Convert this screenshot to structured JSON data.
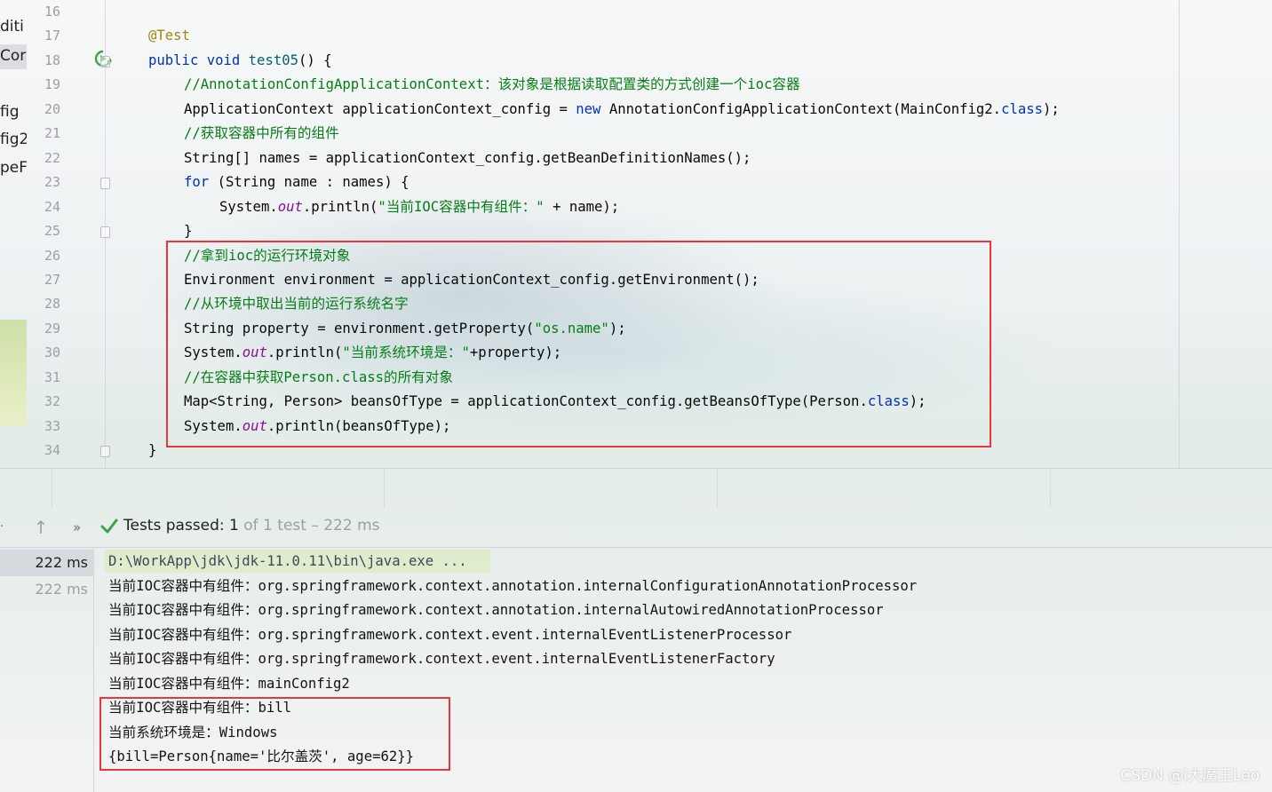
{
  "sidebar": {
    "fragments": [
      "diti",
      "Cor",
      "fig",
      "fig2",
      "peF"
    ]
  },
  "editor": {
    "line_numbers": [
      "16",
      "17",
      "18",
      "19",
      "20",
      "21",
      "22",
      "23",
      "24",
      "25",
      "26",
      "27",
      "28",
      "29",
      "30",
      "31",
      "32",
      "33",
      "34"
    ],
    "lines": [
      {
        "n": "16",
        "segments": []
      },
      {
        "n": "17",
        "segments": [
          {
            "t": "@Test",
            "c": "ann"
          }
        ],
        "indent": 1
      },
      {
        "n": "18",
        "segments": [
          {
            "t": "public ",
            "c": "kw"
          },
          {
            "t": "void ",
            "c": "kw"
          },
          {
            "t": "test05",
            "c": "fn"
          },
          {
            "t": "() {",
            "c": ""
          }
        ],
        "indent": 1
      },
      {
        "n": "19",
        "segments": [
          {
            "t": "//AnnotationConfigApplicationContext：该对象是根据读取配置类的方式创建一个ioc容器",
            "c": "cmt"
          }
        ],
        "indent": 2
      },
      {
        "n": "20",
        "segments": [
          {
            "t": "ApplicationContext applicationContext_config = ",
            "c": ""
          },
          {
            "t": "new ",
            "c": "kw"
          },
          {
            "t": "AnnotationConfigApplicationContext(MainConfig2.",
            "c": ""
          },
          {
            "t": "class",
            "c": "kw"
          },
          {
            "t": ");",
            "c": ""
          }
        ],
        "indent": 2
      },
      {
        "n": "21",
        "segments": [
          {
            "t": "//获取容器中所有的组件",
            "c": "cmt"
          }
        ],
        "indent": 2
      },
      {
        "n": "22",
        "segments": [
          {
            "t": "String[] names = applicationContext_config.getBeanDefinitionNames();",
            "c": ""
          }
        ],
        "indent": 2
      },
      {
        "n": "23",
        "segments": [
          {
            "t": "for ",
            "c": "kw"
          },
          {
            "t": "(String name : names) {",
            "c": ""
          }
        ],
        "indent": 2
      },
      {
        "n": "24",
        "segments": [
          {
            "t": "System.",
            "c": ""
          },
          {
            "t": "out",
            "c": "fld"
          },
          {
            "t": ".println(",
            "c": ""
          },
          {
            "t": "\"当前IOC容器中有组件：\"",
            "c": "str"
          },
          {
            "t": " + name);",
            "c": ""
          }
        ],
        "indent": 3
      },
      {
        "n": "25",
        "segments": [
          {
            "t": "}",
            "c": ""
          }
        ],
        "indent": 2
      },
      {
        "n": "26",
        "segments": [
          {
            "t": "//拿到ioc的运行环境对象",
            "c": "cmt"
          }
        ],
        "indent": 2
      },
      {
        "n": "27",
        "segments": [
          {
            "t": "Environment environment = applicationContext_config.getEnvironment();",
            "c": ""
          }
        ],
        "indent": 2
      },
      {
        "n": "28",
        "segments": [
          {
            "t": "//从环境中取出当前的运行系统名字",
            "c": "cmt"
          }
        ],
        "indent": 2
      },
      {
        "n": "29",
        "segments": [
          {
            "t": "String property = environment.getProperty(",
            "c": ""
          },
          {
            "t": "\"os.name\"",
            "c": "str"
          },
          {
            "t": ");",
            "c": ""
          }
        ],
        "indent": 2
      },
      {
        "n": "30",
        "segments": [
          {
            "t": "System.",
            "c": ""
          },
          {
            "t": "out",
            "c": "fld"
          },
          {
            "t": ".println(",
            "c": ""
          },
          {
            "t": "\"当前系统环境是：\"",
            "c": "str"
          },
          {
            "t": "+property);",
            "c": ""
          }
        ],
        "indent": 2
      },
      {
        "n": "31",
        "segments": [
          {
            "t": "//在容器中获取Person.class的所有对象",
            "c": "cmt"
          }
        ],
        "indent": 2
      },
      {
        "n": "32",
        "segments": [
          {
            "t": "Map<String, Person> beansOfType = applicationContext_config.getBeansOfType(Person.",
            "c": ""
          },
          {
            "t": "class",
            "c": "kw"
          },
          {
            "t": ");",
            "c": ""
          }
        ],
        "indent": 2
      },
      {
        "n": "33",
        "segments": [
          {
            "t": "System.",
            "c": ""
          },
          {
            "t": "out",
            "c": "fld"
          },
          {
            "t": ".println(beansOfType);",
            "c": ""
          }
        ],
        "indent": 2
      },
      {
        "n": "34",
        "segments": [
          {
            "t": "}",
            "c": ""
          }
        ],
        "indent": 1
      }
    ]
  },
  "test_toolbar": {
    "status_strong": "Tests passed: 1",
    "status_dim": " of 1 test – 222 ms",
    "more_label": "»",
    "up_label": "↑",
    "dot_label": "·"
  },
  "test_tree": {
    "rows": [
      {
        "label": "222 ms",
        "selected": true
      },
      {
        "label": "222 ms",
        "selected": false
      }
    ]
  },
  "console": {
    "lines": [
      "D:\\WorkApp\\jdk\\jdk-11.0.11\\bin\\java.exe ...",
      "当前IOC容器中有组件：org.springframework.context.annotation.internalConfigurationAnnotationProcessor",
      "当前IOC容器中有组件：org.springframework.context.annotation.internalAutowiredAnnotationProcessor",
      "当前IOC容器中有组件：org.springframework.context.event.internalEventListenerProcessor",
      "当前IOC容器中有组件：org.springframework.context.event.internalEventListenerFactory",
      "当前IOC容器中有组件：mainConfig2",
      "当前IOC容器中有组件：bill",
      "当前系统环境是：Windows",
      "{bill=Person{name='比尔盖茨', age=62}}"
    ]
  },
  "watermark": "CSDN @i大魔王Leo",
  "colors": {
    "keyword": "#0033b3",
    "annotation": "#9e880d",
    "comment": "#067d17",
    "field": "#871094",
    "highlight_box": "#e8363c",
    "pass_check": "#3ea347"
  },
  "icons": [
    "run-test-icon",
    "fold-marker-icon",
    "arrow-up-icon",
    "more-icon",
    "check-icon"
  ]
}
